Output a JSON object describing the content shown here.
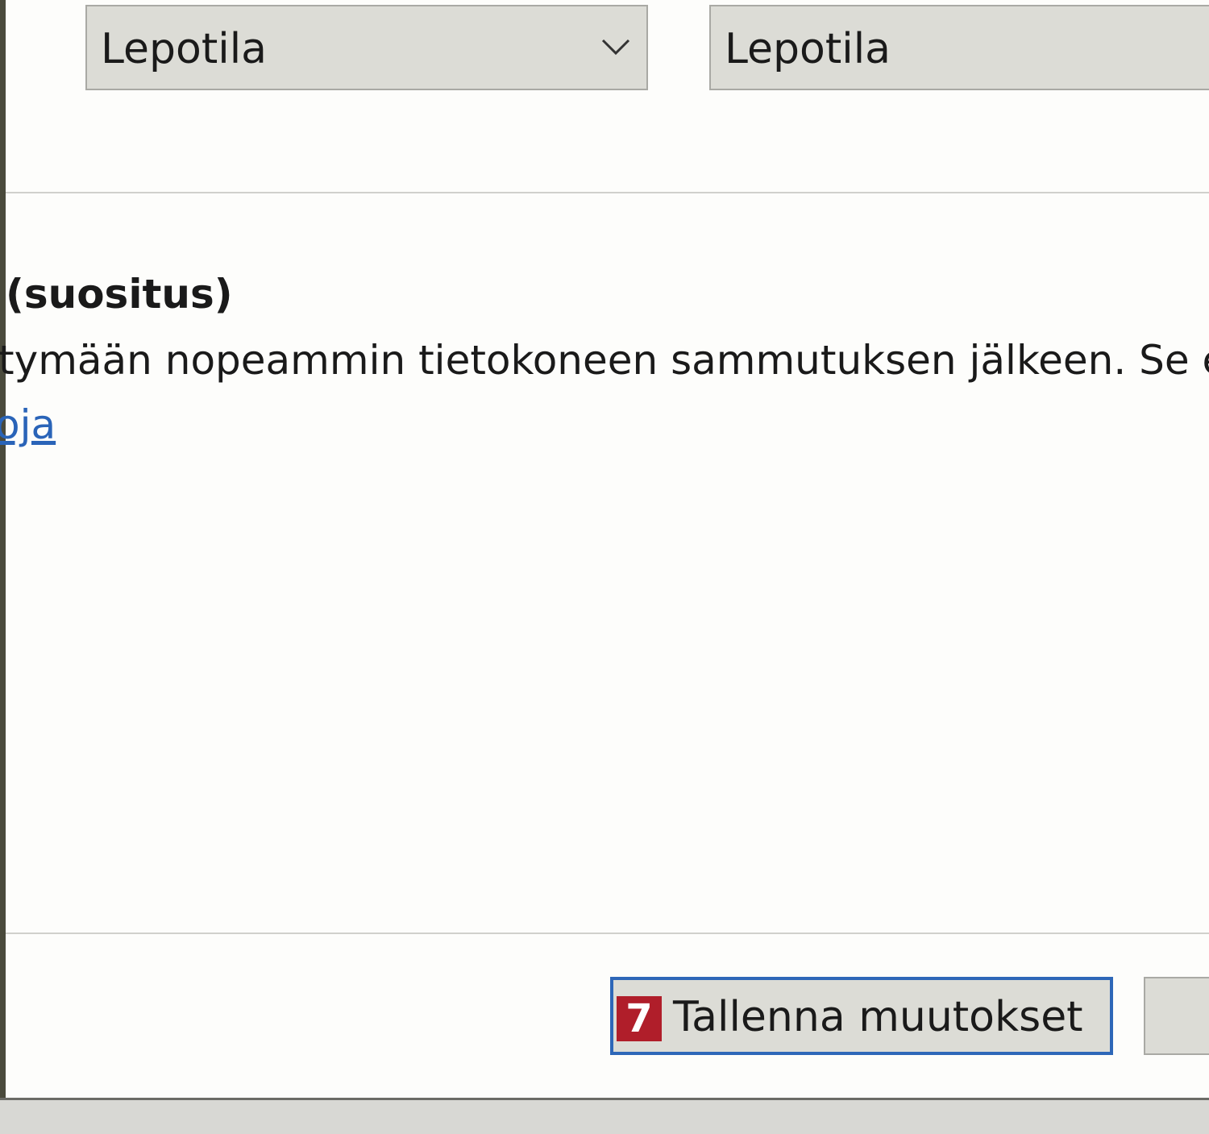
{
  "power_settings": {
    "select_left": {
      "value": "Lepotila",
      "icon": "chevron-down-icon"
    },
    "select_right": {
      "value": "Lepotila"
    }
  },
  "fast_startup": {
    "heading": "(suositus)",
    "description": "tymään nopeammin tietokoneen sammutuksen jälkeen. Se ei",
    "link": "oja"
  },
  "footer": {
    "save_badge": "7",
    "save_label": "Tallenna muutokset"
  },
  "colors": {
    "accent": "#2e67b8",
    "badge": "#b01e2a",
    "link": "#2a64b8"
  }
}
